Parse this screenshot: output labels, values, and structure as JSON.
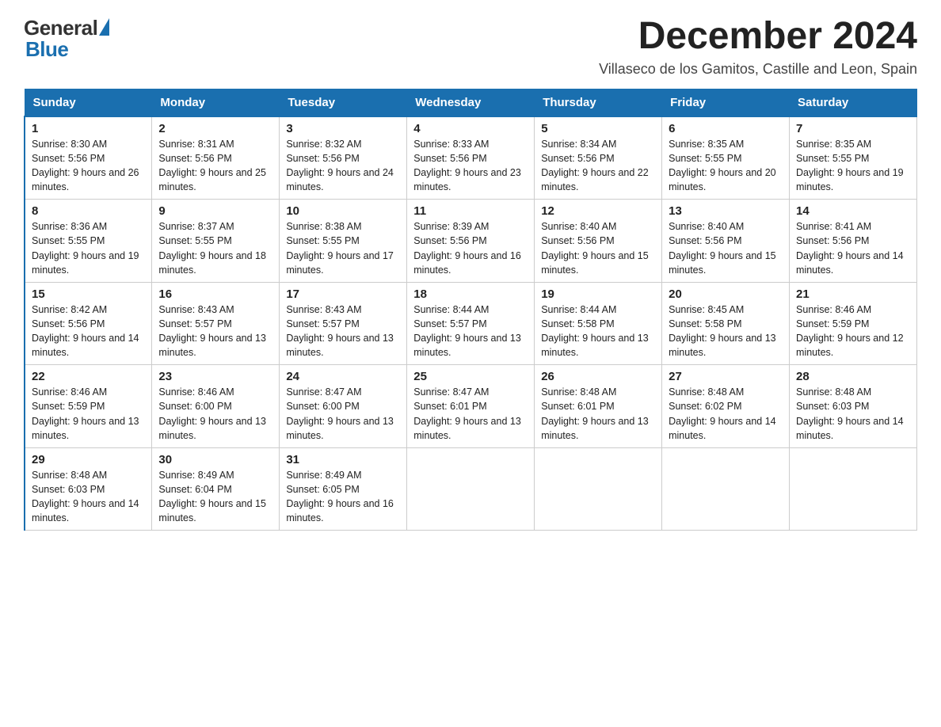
{
  "logo": {
    "word1": "General",
    "word2": "Blue"
  },
  "title": "December 2024",
  "subtitle": "Villaseco de los Gamitos, Castille and Leon, Spain",
  "days_of_week": [
    "Sunday",
    "Monday",
    "Tuesday",
    "Wednesday",
    "Thursday",
    "Friday",
    "Saturday"
  ],
  "weeks": [
    [
      {
        "num": "1",
        "sunrise": "Sunrise: 8:30 AM",
        "sunset": "Sunset: 5:56 PM",
        "daylight": "Daylight: 9 hours and 26 minutes."
      },
      {
        "num": "2",
        "sunrise": "Sunrise: 8:31 AM",
        "sunset": "Sunset: 5:56 PM",
        "daylight": "Daylight: 9 hours and 25 minutes."
      },
      {
        "num": "3",
        "sunrise": "Sunrise: 8:32 AM",
        "sunset": "Sunset: 5:56 PM",
        "daylight": "Daylight: 9 hours and 24 minutes."
      },
      {
        "num": "4",
        "sunrise": "Sunrise: 8:33 AM",
        "sunset": "Sunset: 5:56 PM",
        "daylight": "Daylight: 9 hours and 23 minutes."
      },
      {
        "num": "5",
        "sunrise": "Sunrise: 8:34 AM",
        "sunset": "Sunset: 5:56 PM",
        "daylight": "Daylight: 9 hours and 22 minutes."
      },
      {
        "num": "6",
        "sunrise": "Sunrise: 8:35 AM",
        "sunset": "Sunset: 5:55 PM",
        "daylight": "Daylight: 9 hours and 20 minutes."
      },
      {
        "num": "7",
        "sunrise": "Sunrise: 8:35 AM",
        "sunset": "Sunset: 5:55 PM",
        "daylight": "Daylight: 9 hours and 19 minutes."
      }
    ],
    [
      {
        "num": "8",
        "sunrise": "Sunrise: 8:36 AM",
        "sunset": "Sunset: 5:55 PM",
        "daylight": "Daylight: 9 hours and 19 minutes."
      },
      {
        "num": "9",
        "sunrise": "Sunrise: 8:37 AM",
        "sunset": "Sunset: 5:55 PM",
        "daylight": "Daylight: 9 hours and 18 minutes."
      },
      {
        "num": "10",
        "sunrise": "Sunrise: 8:38 AM",
        "sunset": "Sunset: 5:55 PM",
        "daylight": "Daylight: 9 hours and 17 minutes."
      },
      {
        "num": "11",
        "sunrise": "Sunrise: 8:39 AM",
        "sunset": "Sunset: 5:56 PM",
        "daylight": "Daylight: 9 hours and 16 minutes."
      },
      {
        "num": "12",
        "sunrise": "Sunrise: 8:40 AM",
        "sunset": "Sunset: 5:56 PM",
        "daylight": "Daylight: 9 hours and 15 minutes."
      },
      {
        "num": "13",
        "sunrise": "Sunrise: 8:40 AM",
        "sunset": "Sunset: 5:56 PM",
        "daylight": "Daylight: 9 hours and 15 minutes."
      },
      {
        "num": "14",
        "sunrise": "Sunrise: 8:41 AM",
        "sunset": "Sunset: 5:56 PM",
        "daylight": "Daylight: 9 hours and 14 minutes."
      }
    ],
    [
      {
        "num": "15",
        "sunrise": "Sunrise: 8:42 AM",
        "sunset": "Sunset: 5:56 PM",
        "daylight": "Daylight: 9 hours and 14 minutes."
      },
      {
        "num": "16",
        "sunrise": "Sunrise: 8:43 AM",
        "sunset": "Sunset: 5:57 PM",
        "daylight": "Daylight: 9 hours and 13 minutes."
      },
      {
        "num": "17",
        "sunrise": "Sunrise: 8:43 AM",
        "sunset": "Sunset: 5:57 PM",
        "daylight": "Daylight: 9 hours and 13 minutes."
      },
      {
        "num": "18",
        "sunrise": "Sunrise: 8:44 AM",
        "sunset": "Sunset: 5:57 PM",
        "daylight": "Daylight: 9 hours and 13 minutes."
      },
      {
        "num": "19",
        "sunrise": "Sunrise: 8:44 AM",
        "sunset": "Sunset: 5:58 PM",
        "daylight": "Daylight: 9 hours and 13 minutes."
      },
      {
        "num": "20",
        "sunrise": "Sunrise: 8:45 AM",
        "sunset": "Sunset: 5:58 PM",
        "daylight": "Daylight: 9 hours and 13 minutes."
      },
      {
        "num": "21",
        "sunrise": "Sunrise: 8:46 AM",
        "sunset": "Sunset: 5:59 PM",
        "daylight": "Daylight: 9 hours and 12 minutes."
      }
    ],
    [
      {
        "num": "22",
        "sunrise": "Sunrise: 8:46 AM",
        "sunset": "Sunset: 5:59 PM",
        "daylight": "Daylight: 9 hours and 13 minutes."
      },
      {
        "num": "23",
        "sunrise": "Sunrise: 8:46 AM",
        "sunset": "Sunset: 6:00 PM",
        "daylight": "Daylight: 9 hours and 13 minutes."
      },
      {
        "num": "24",
        "sunrise": "Sunrise: 8:47 AM",
        "sunset": "Sunset: 6:00 PM",
        "daylight": "Daylight: 9 hours and 13 minutes."
      },
      {
        "num": "25",
        "sunrise": "Sunrise: 8:47 AM",
        "sunset": "Sunset: 6:01 PM",
        "daylight": "Daylight: 9 hours and 13 minutes."
      },
      {
        "num": "26",
        "sunrise": "Sunrise: 8:48 AM",
        "sunset": "Sunset: 6:01 PM",
        "daylight": "Daylight: 9 hours and 13 minutes."
      },
      {
        "num": "27",
        "sunrise": "Sunrise: 8:48 AM",
        "sunset": "Sunset: 6:02 PM",
        "daylight": "Daylight: 9 hours and 14 minutes."
      },
      {
        "num": "28",
        "sunrise": "Sunrise: 8:48 AM",
        "sunset": "Sunset: 6:03 PM",
        "daylight": "Daylight: 9 hours and 14 minutes."
      }
    ],
    [
      {
        "num": "29",
        "sunrise": "Sunrise: 8:48 AM",
        "sunset": "Sunset: 6:03 PM",
        "daylight": "Daylight: 9 hours and 14 minutes."
      },
      {
        "num": "30",
        "sunrise": "Sunrise: 8:49 AM",
        "sunset": "Sunset: 6:04 PM",
        "daylight": "Daylight: 9 hours and 15 minutes."
      },
      {
        "num": "31",
        "sunrise": "Sunrise: 8:49 AM",
        "sunset": "Sunset: 6:05 PM",
        "daylight": "Daylight: 9 hours and 16 minutes."
      },
      null,
      null,
      null,
      null
    ]
  ]
}
